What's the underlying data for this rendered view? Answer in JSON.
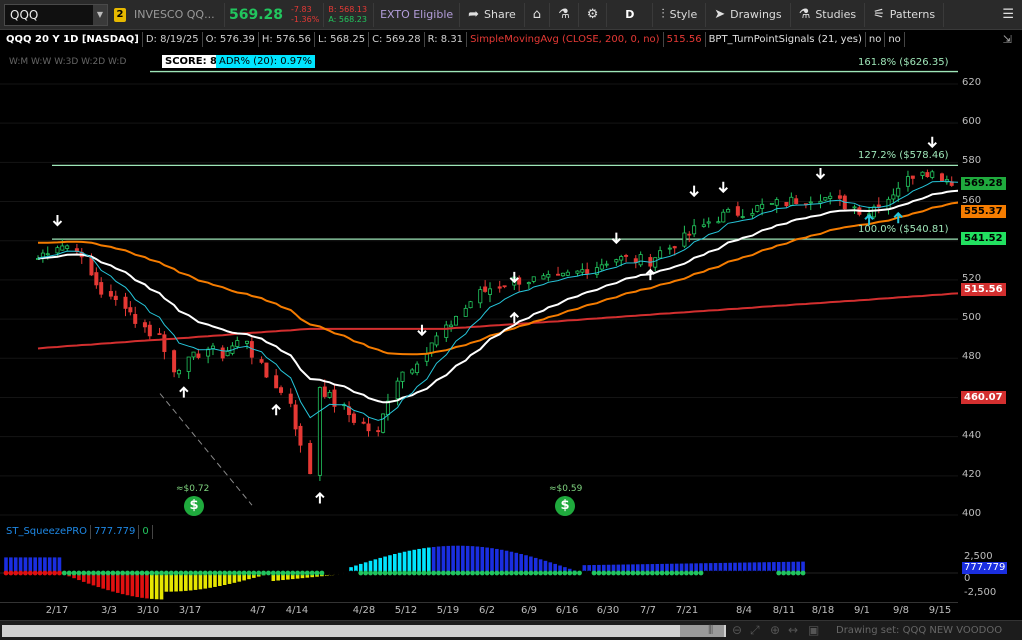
{
  "toolbar": {
    "symbol": "QQQ",
    "badge": "2",
    "description": "INVESCO QQ...",
    "price": "569.28",
    "change": "-7.83",
    "change_pct": "-1.36%",
    "bid": "B: 568.13",
    "ask": "A: 568.23",
    "exto": "EXTO Eligible",
    "share": "Share",
    "period": "D",
    "style": "Style",
    "drawings": "Drawings",
    "studies": "Studies",
    "patterns": "Patterns"
  },
  "header": {
    "title": "QQQ 20 Y 1D [NASDAQ]",
    "date": "D: 8/19/25",
    "open": "O: 576.39",
    "high": "H: 576.56",
    "low": "L: 568.25",
    "close": "C: 569.28",
    "range": "R: 8.31",
    "sma": "SimpleMovingAvg (CLOSE, 200, 0, no)",
    "sma_value": "515.56",
    "bpt": "BPT_TurnPointSignals (21, yes)",
    "opt1": "no",
    "opt2": "no",
    "timeframes": "W:M  W:W  W:3D  W:2D  W:D",
    "score": "SCORE: 8",
    "adr": "ADR% (20): 0.97%"
  },
  "fib": [
    {
      "label": "161.8%  ($626.35)",
      "price": 626.35
    },
    {
      "label": "127.2%  ($578.46)",
      "price": 578.46
    },
    {
      "label": "100.0%  ($540.81)",
      "price": 540.81
    }
  ],
  "y_axis": {
    "ticks": [
      "620",
      "600",
      "580",
      "560",
      "540",
      "520",
      "500",
      "480",
      "460",
      "440",
      "420",
      "400"
    ],
    "tick_values": [
      620,
      600,
      580,
      560,
      540,
      520,
      500,
      480,
      460,
      440,
      420,
      400
    ],
    "labels": [
      {
        "text": "569.28",
        "price": 569.28,
        "bg": "#1faa3d",
        "fg": "#000000"
      },
      {
        "text": "555.37",
        "price": 555.37,
        "bg": "#f57c00",
        "fg": "#000000"
      },
      {
        "text": "541.52",
        "price": 541.52,
        "bg": "#22e060",
        "fg": "#000000"
      },
      {
        "text": "515.56",
        "price": 515.56,
        "bg": "#d32f2f",
        "fg": "#ffffff"
      },
      {
        "text": "460.07",
        "price": 460.07,
        "bg": "#d32f2f",
        "fg": "#ffffff"
      }
    ]
  },
  "dividends": [
    {
      "label": "≈$0.72",
      "symbol": "$"
    },
    {
      "label": "≈$0.59",
      "symbol": "$"
    }
  ],
  "x_axis": {
    "ticks": [
      "2/17",
      "3/3",
      "3/10",
      "3/17",
      "4/7",
      "4/14",
      "4/28",
      "5/12",
      "5/19",
      "6/2",
      "6/9",
      "6/16",
      "6/30",
      "7/7",
      "7/21",
      "8/4",
      "8/11",
      "8/18",
      "9/1",
      "9/8",
      "9/15"
    ]
  },
  "oscillator": {
    "name": "ST_SqueezePRO",
    "value": "777.779",
    "value2": "0",
    "ticks": [
      "2,500",
      "0",
      "-2,500"
    ]
  },
  "bottom": {
    "drawing_set": "Drawing set: QQQ NEW VOODOO"
  },
  "colors": {
    "up": "#22c55e",
    "down": "#e53935",
    "sma200": "#d32f2f",
    "ema50": "#f57c00",
    "ema21": "#ffffff",
    "ema8": "#26c6da",
    "fib": "#9ee6b8"
  },
  "chart_data": {
    "type": "candlestick",
    "title": "QQQ 20 Y 1D [NASDAQ]",
    "ylim": [
      400,
      630
    ],
    "close_path": [
      [
        "2025-02-10",
        531
      ],
      [
        "2025-02-14",
        538
      ],
      [
        "2025-02-18",
        537
      ],
      [
        "2025-02-21",
        522
      ],
      [
        "2025-02-25",
        510
      ],
      [
        "2025-02-28",
        508
      ],
      [
        "2025-03-04",
        495
      ],
      [
        "2025-03-07",
        492
      ],
      [
        "2025-03-10",
        475
      ],
      [
        "2025-03-13",
        478
      ],
      [
        "2025-03-17",
        485
      ],
      [
        "2025-03-20",
        482
      ],
      [
        "2025-03-25",
        490
      ],
      [
        "2025-03-28",
        475
      ],
      [
        "2025-04-03",
        458
      ],
      [
        "2025-04-07",
        422
      ],
      [
        "2025-04-09",
        466
      ],
      [
        "2025-04-14",
        454
      ],
      [
        "2025-04-21",
        441
      ],
      [
        "2025-04-25",
        470
      ],
      [
        "2025-05-01",
        483
      ],
      [
        "2025-05-12",
        513
      ],
      [
        "2025-05-19",
        520
      ],
      [
        "2025-05-28",
        520
      ],
      [
        "2025-06-09",
        531
      ],
      [
        "2025-06-16",
        530
      ],
      [
        "2025-06-30",
        552
      ],
      [
        "2025-07-07",
        556
      ],
      [
        "2025-07-21",
        563
      ],
      [
        "2025-07-31",
        555
      ],
      [
        "2025-08-04",
        562
      ],
      [
        "2025-08-11",
        577
      ],
      [
        "2025-08-19",
        569.28
      ]
    ],
    "series": [
      {
        "name": "SimpleMovingAvg (CLOSE, 200, 0, no)",
        "last": 515.56
      }
    ]
  }
}
